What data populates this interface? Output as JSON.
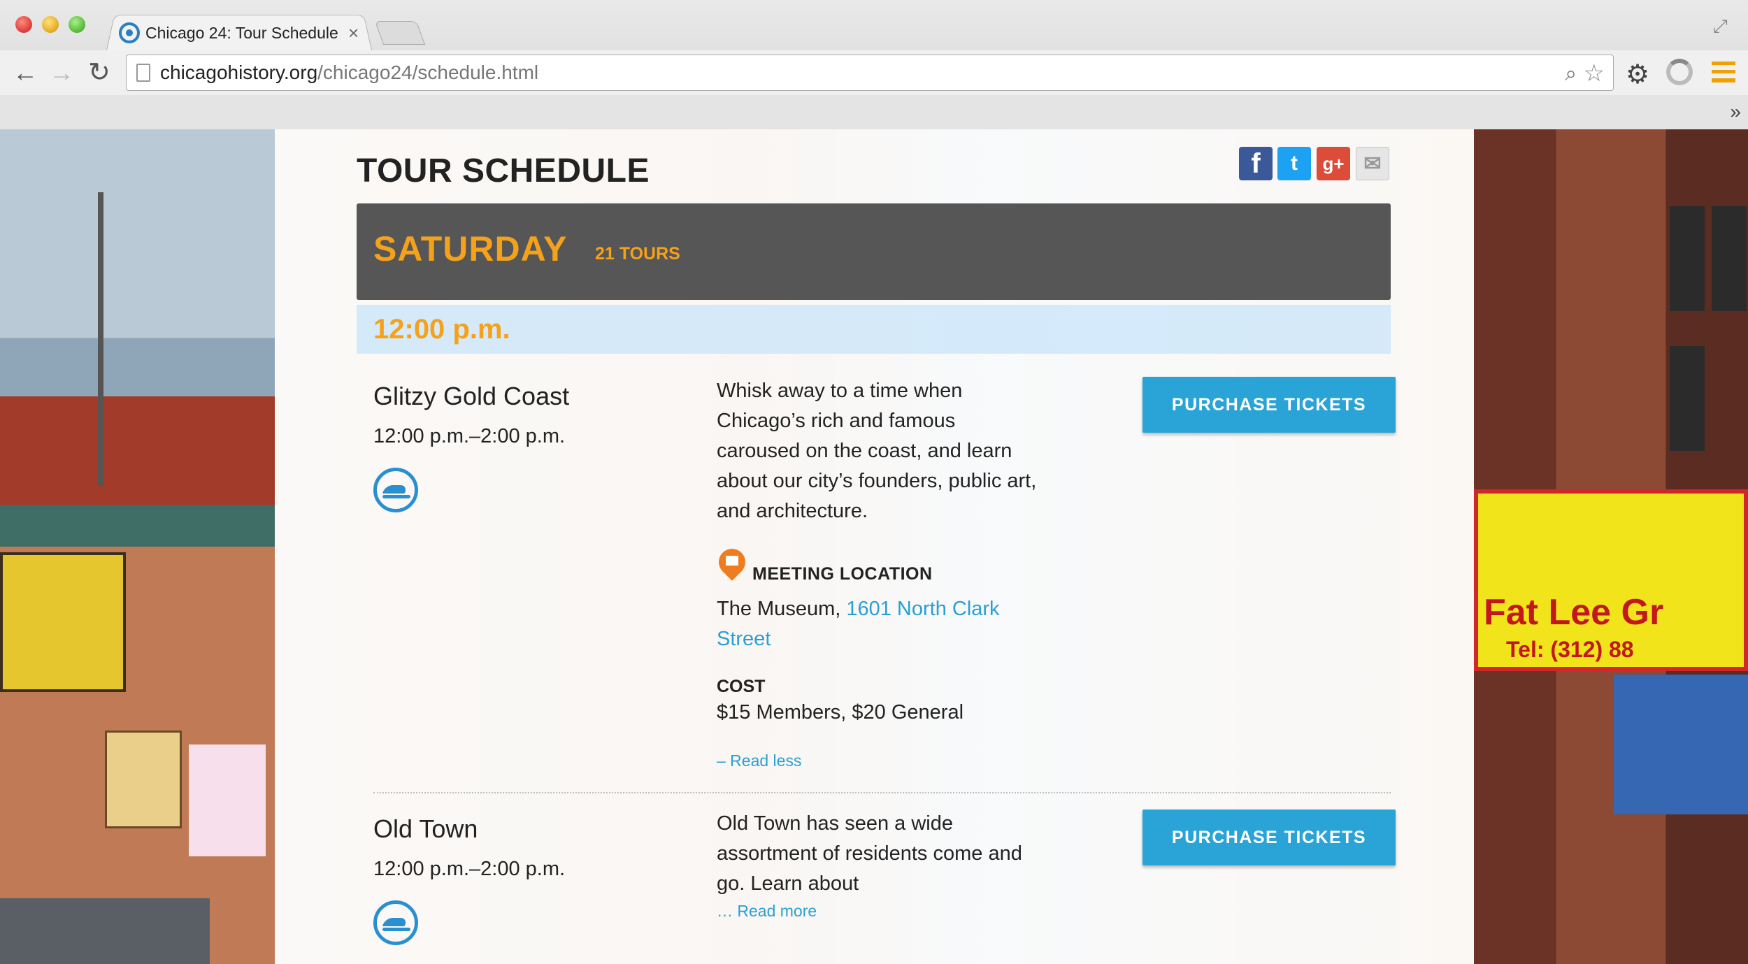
{
  "browser": {
    "tab_title": "Chicago 24: Tour Schedule",
    "tab_close": "×",
    "url_host": "chicagohistory.org",
    "url_path": "/chicago24/schedule.html",
    "bookmarks_chevron": "»"
  },
  "background": {
    "right_sign_text": "Fat Lee Gr",
    "right_sign_tel": "Tel: (312) 88"
  },
  "page": {
    "title": "TOUR SCHEDULE",
    "share": {
      "facebook": "f",
      "twitter": "t",
      "google_plus": "g+",
      "email": "✉"
    },
    "day": {
      "name": "SATURDAY",
      "count": "21 TOURS"
    },
    "time_slot": "12:00 p.m.",
    "tours": [
      {
        "name": "Glitzy Gold Coast",
        "time": "12:00 p.m.–2:00 p.m.",
        "description": "Whisk away to a time when Chicago’s rich and famous caroused on the coast, and learn about our city’s founders, public art, and architecture.",
        "button": "PURCHASE TICKETS",
        "meeting_label": "MEETING LOCATION",
        "meeting_place": "The Museum, ",
        "meeting_address": "1601 North Clark Street",
        "cost_label": "COST",
        "cost_value": "$15 Members, $20 General",
        "toggle": "– Read less"
      },
      {
        "name": "Old Town",
        "time": "12:00 p.m.–2:00 p.m.",
        "description": "Old Town has seen a wide assortment of residents come and go. Learn about",
        "button": "PURCHASE TICKETS",
        "toggle": "… Read more"
      }
    ]
  },
  "colors": {
    "accent_orange": "#f5a11a",
    "button_blue": "#2aa4d6",
    "link_blue": "#2a9fd4",
    "day_bar": "#565656"
  }
}
